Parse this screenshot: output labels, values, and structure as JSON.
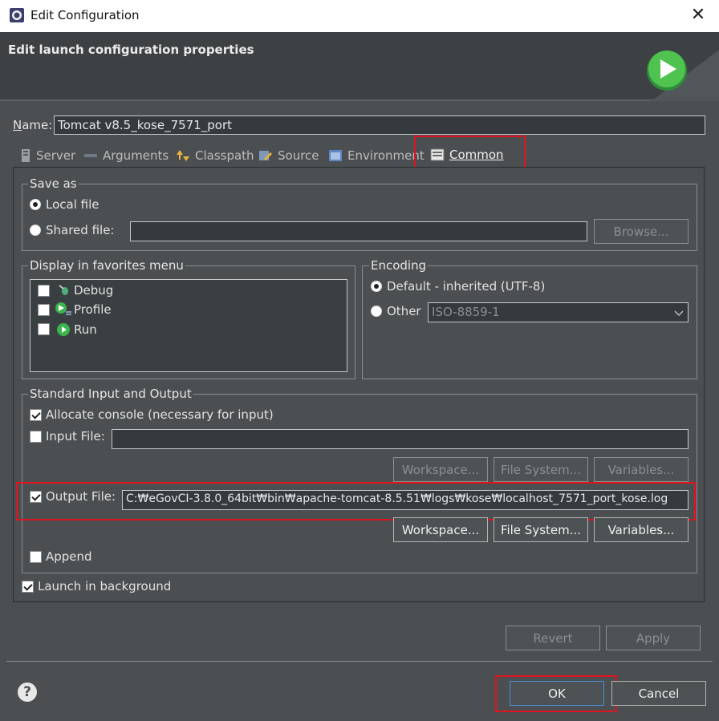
{
  "window": {
    "title": "Edit Configuration",
    "close_glyph": "✕"
  },
  "header": {
    "title": "Edit launch configuration properties"
  },
  "name_field": {
    "label": "Name:",
    "value": "Tomcat v8.5_kose_7571_port"
  },
  "tabs": [
    {
      "label": "Server",
      "icon": "server-icon"
    },
    {
      "label": "Arguments",
      "icon": "arguments-icon"
    },
    {
      "label": "Classpath",
      "icon": "classpath-icon"
    },
    {
      "label": "Source",
      "icon": "source-icon"
    },
    {
      "label": "Environment",
      "icon": "environment-icon"
    },
    {
      "label": "Common",
      "icon": "common-icon",
      "selected": true
    }
  ],
  "save_as": {
    "title": "Save as",
    "local_file": "Local file",
    "shared_file": "Shared file:",
    "shared_value": "",
    "browse": "Browse..."
  },
  "favorites": {
    "title": "Display in favorites menu",
    "items": [
      {
        "label": "Debug",
        "checked": false
      },
      {
        "label": "Profile",
        "checked": false
      },
      {
        "label": "Run",
        "checked": false
      }
    ]
  },
  "encoding": {
    "title": "Encoding",
    "default_label": "Default - inherited (UTF-8)",
    "other_label": "Other",
    "other_value": "ISO-8859-1"
  },
  "stdio": {
    "title": "Standard Input and Output",
    "allocate_console": "Allocate console (necessary for input)",
    "input_file": "Input File:",
    "input_value": "",
    "output_file": "Output File:",
    "output_value": "C:₩eGovCI-3.8.0_64bit₩bin₩apache-tomcat-8.5.51₩logs₩kose₩localhost_7571_port_kose.log",
    "workspace": "Workspace...",
    "file_system": "File System...",
    "variables": "Variables...",
    "append": "Append"
  },
  "launch_in_background": "Launch in background",
  "buttons": {
    "revert": "Revert",
    "apply": "Apply",
    "ok": "OK",
    "cancel": "Cancel",
    "help": "?"
  },
  "colors": {
    "highlight": "#e0141e",
    "run_green": "#3cb44b",
    "background": "#4b4f52"
  }
}
